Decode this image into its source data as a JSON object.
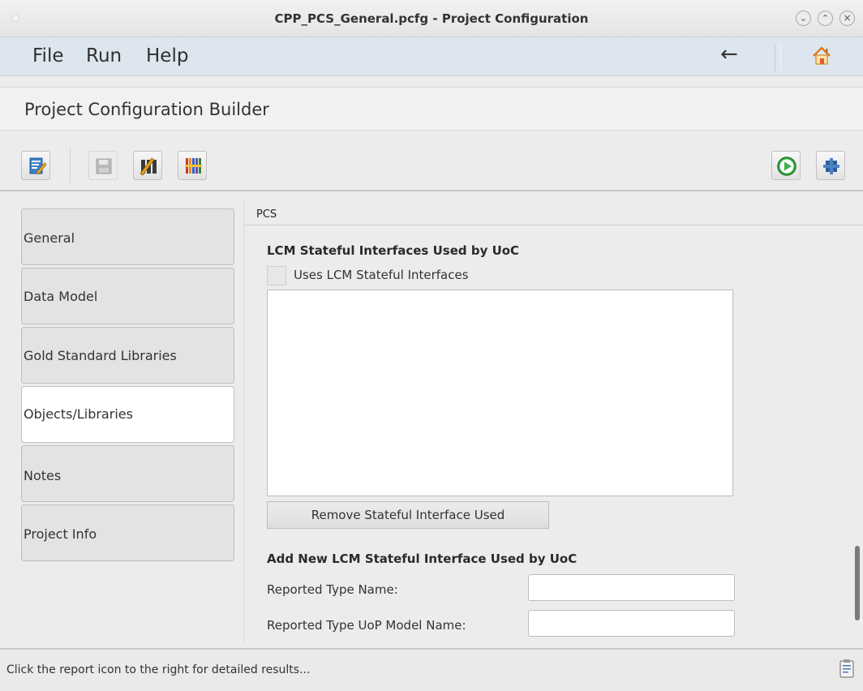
{
  "window": {
    "title": "CPP_PCS_General.pcfg - Project Configuration",
    "controls": [
      "minimize",
      "maximize",
      "close"
    ]
  },
  "menu": {
    "items": [
      "File",
      "Run",
      "Help"
    ],
    "back_icon": "back-arrow-icon",
    "home_icon": "home-icon"
  },
  "header": {
    "title": "Project Configuration Builder"
  },
  "toolbar": {
    "left_icons": [
      "edit-config-icon",
      "save-icon",
      "validate-icon",
      "library-icon"
    ],
    "right_icons": [
      "run-icon",
      "settings-icon"
    ]
  },
  "sidebar": {
    "items": [
      {
        "label": "General",
        "active": false
      },
      {
        "label": "Data Model",
        "active": false
      },
      {
        "label": "Gold Standard Libraries",
        "active": false
      },
      {
        "label": "Objects/Libraries",
        "active": true
      },
      {
        "label": "Notes",
        "active": false
      },
      {
        "label": "Project Info",
        "active": false
      }
    ]
  },
  "main": {
    "tab": "PCS",
    "section_title": "LCM Stateful Interfaces Used by UoC",
    "checkbox_label": "Uses LCM Stateful Interfaces",
    "checkbox_checked": false,
    "remove_button": "Remove Stateful Interface Used",
    "add_title": "Add New LCM Stateful Interface Used by UoC",
    "fields": [
      {
        "label": "Reported Type Name:",
        "value": ""
      },
      {
        "label": "Reported Type UoP Model Name:",
        "value": ""
      }
    ]
  },
  "status": {
    "text": "Click the report icon to the right for detailed results...",
    "icon": "report-icon"
  }
}
